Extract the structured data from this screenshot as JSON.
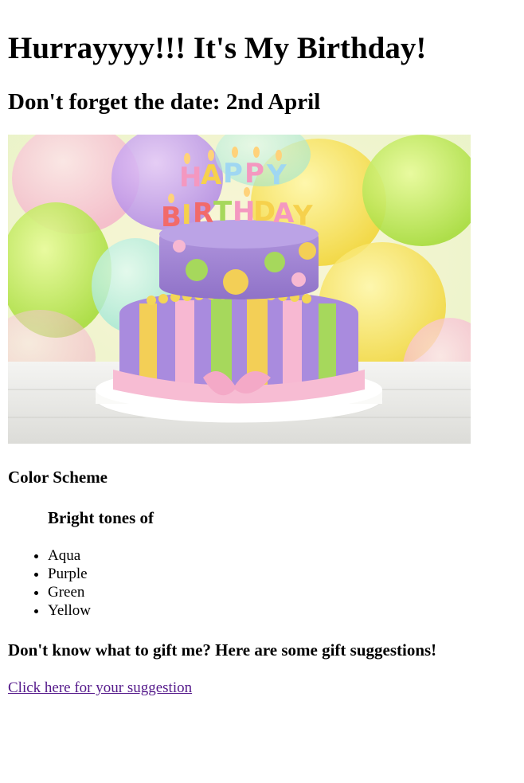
{
  "title": "Hurrayyyy!!! It's My Birthday!",
  "subtitle": "Don't forget the date: 2nd April",
  "image": {
    "icon": "birthday-cake-image"
  },
  "color_scheme": {
    "heading": "Color Scheme",
    "subheading": "Bright tones of",
    "items": [
      "Aqua",
      "Purple",
      "Green",
      "Yellow"
    ]
  },
  "gift": {
    "heading": "Don't know what to gift me? Here are some gift suggestions!",
    "link_label": "Click here for your suggestion",
    "link_color": "#551a8b"
  },
  "colors": {
    "aqua": "#7fe0d8",
    "purple": "#9b7fd6",
    "green": "#a8d45a",
    "yellow": "#f2cf4e",
    "pink": "#f5b6cc"
  }
}
